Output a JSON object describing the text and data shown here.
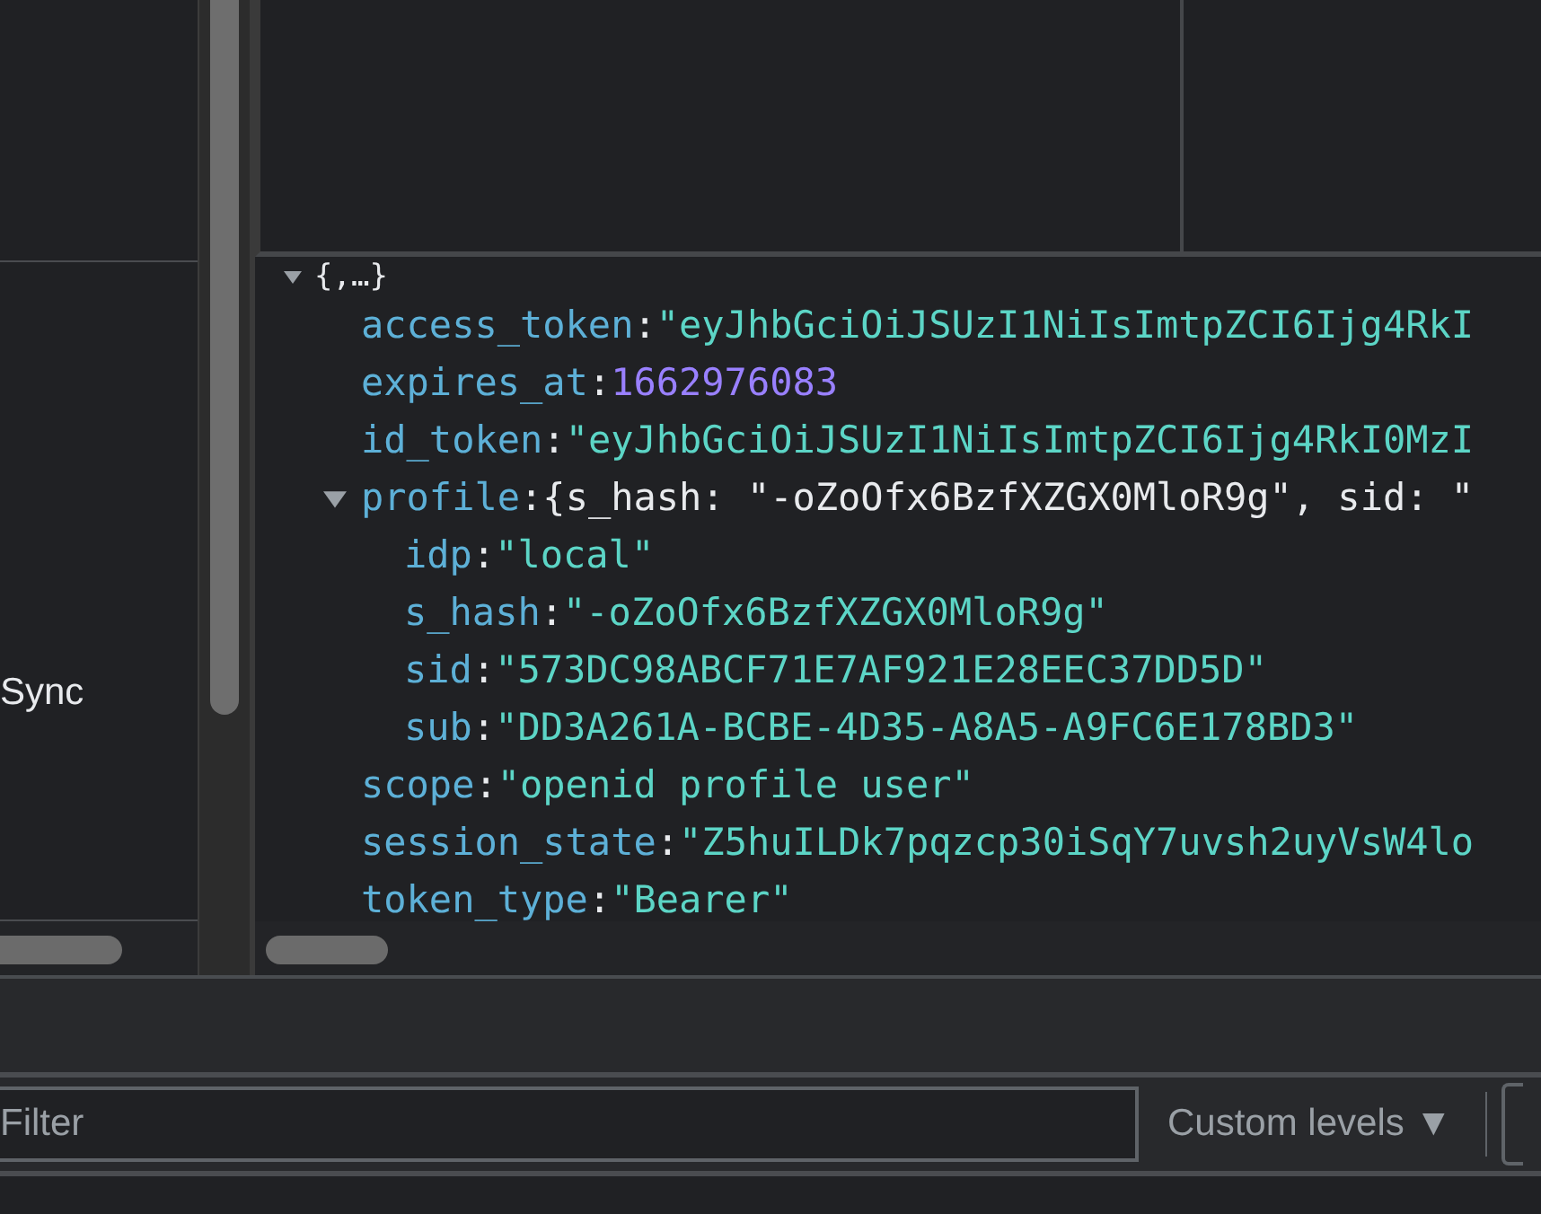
{
  "left_pane": {
    "item": "Sync"
  },
  "tree": {
    "label": "{,…}",
    "expanded": true,
    "children": [
      {
        "key": "access_token",
        "colon": ":",
        "value": "\"eyJhbGciOiJSUzI1NiIsImtpZCI6Ijg4RkI",
        "kind": "string"
      },
      {
        "key": "expires_at",
        "colon": ":",
        "value": "1662976083",
        "kind": "number"
      },
      {
        "key": "id_token",
        "colon": ":",
        "value": "\"eyJhbGciOiJSUzI1NiIsImtpZCI6Ijg4RkI0MzI",
        "kind": "string"
      },
      {
        "key": "profile",
        "colon": ":",
        "value": "{s_hash: \"-oZoOfx6BzfXZGX0MloR9g\", sid: \"",
        "kind": "object",
        "expanded": true,
        "children": [
          {
            "key": "idp",
            "colon": ":",
            "value": "\"local\"",
            "kind": "string"
          },
          {
            "key": "s_hash",
            "colon": ":",
            "value": "\"-oZoOfx6BzfXZGX0MloR9g\"",
            "kind": "string"
          },
          {
            "key": "sid",
            "colon": ":",
            "value": "\"573DC98ABCF71E7AF921E28EEC37DD5D\"",
            "kind": "string"
          },
          {
            "key": "sub",
            "colon": ":",
            "value": "\"DD3A261A-BCBE-4D35-A8A5-A9FC6E178BD3\"",
            "kind": "string"
          }
        ]
      },
      {
        "key": "scope",
        "colon": ":",
        "value": "\"openid profile user\"",
        "kind": "string"
      },
      {
        "key": "session_state",
        "colon": ":",
        "value": "\"Z5huILDk7pqzcp30iSqY7uvsh2uyVsW4lo",
        "kind": "string"
      },
      {
        "key": "token_type",
        "colon": ":",
        "value": "\"Bearer\"",
        "kind": "string"
      }
    ]
  },
  "console_toolbar": {
    "filter": {
      "placeholder": "Filter"
    },
    "levels_button": "Custom levels ▼"
  }
}
